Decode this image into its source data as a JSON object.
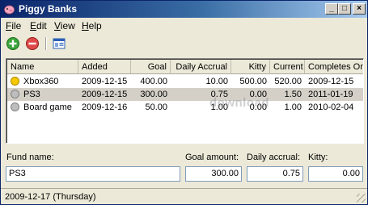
{
  "window": {
    "title": "Piggy Banks",
    "controls": {
      "minimize": "_",
      "maximize": "□",
      "close": "×"
    }
  },
  "menu": {
    "items": [
      {
        "label": "File",
        "mnemonic": "F",
        "rest": "ile"
      },
      {
        "label": "Edit",
        "mnemonic": "E",
        "rest": "dit"
      },
      {
        "label": "View",
        "mnemonic": "V",
        "rest": "iew"
      },
      {
        "label": "Help",
        "mnemonic": "H",
        "rest": "elp"
      }
    ]
  },
  "toolbar": {
    "add_icon": "add-circle-icon",
    "remove_icon": "remove-circle-icon",
    "properties_icon": "window-properties-icon"
  },
  "table": {
    "columns": [
      "Name",
      "Added",
      "Goal",
      "Daily Accrual",
      "Kitty",
      "Current",
      "Completes On"
    ],
    "rows": [
      {
        "status": "yellow",
        "name": "Xbox360",
        "added": "2009-12-15",
        "goal": "400.00",
        "daily": "10.00",
        "kitty": "500.00",
        "current": "520.00",
        "completes": "2009-12-15"
      },
      {
        "status": "grey",
        "name": "PS3",
        "added": "2009-12-15",
        "goal": "300.00",
        "daily": "0.75",
        "kitty": "0.00",
        "current": "1.50",
        "completes": "2011-01-19"
      },
      {
        "status": "grey",
        "name": "Board game",
        "added": "2009-12-16",
        "goal": "50.00",
        "daily": "1.00",
        "kitty": "0.00",
        "current": "1.00",
        "completes": "2010-02-04"
      }
    ],
    "selected_index": 1
  },
  "watermark": "download",
  "form": {
    "fund_name_label": "Fund name:",
    "fund_name_value": "PS3",
    "goal_label": "Goal amount:",
    "goal_value": "300.00",
    "daily_label": "Daily accrual:",
    "daily_value": "0.75",
    "kitty_label": "Kitty:",
    "kitty_value": "0.00"
  },
  "status": {
    "text": "2009-12-17  (Thursday)"
  },
  "colors": {
    "title_gradient_start": "#0a246a",
    "status_yellow": "#f5c800",
    "status_grey": "#bdbdbd"
  }
}
